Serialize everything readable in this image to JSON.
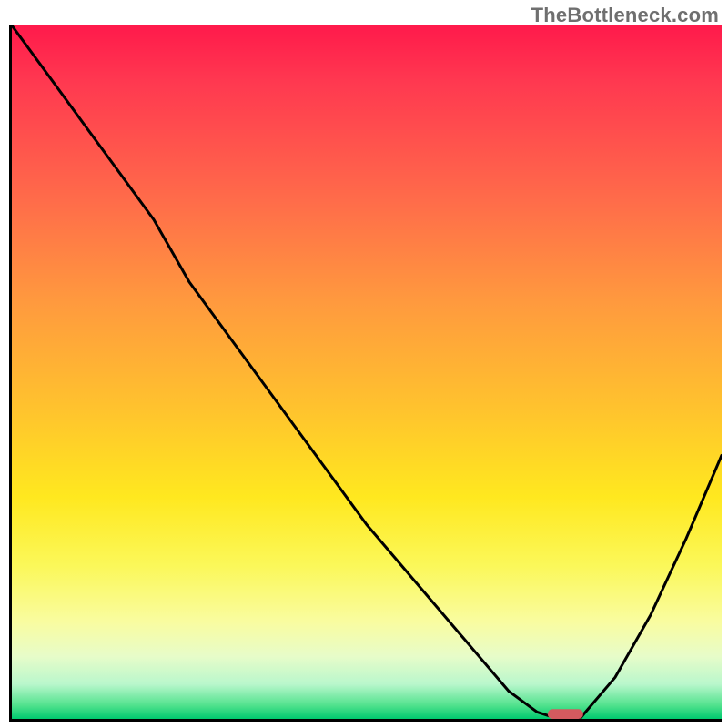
{
  "watermark": "TheBottleneck.com",
  "chart_data": {
    "type": "line",
    "title": "",
    "xlabel": "",
    "ylabel": "",
    "xlim": [
      0,
      100
    ],
    "ylim": [
      0,
      100
    ],
    "grid": false,
    "legend": false,
    "background": {
      "type": "vertical-gradient",
      "stops": [
        {
          "pos": 0.0,
          "color": "#ff1a4b"
        },
        {
          "pos": 0.08,
          "color": "#ff3850"
        },
        {
          "pos": 0.25,
          "color": "#ff6b4a"
        },
        {
          "pos": 0.4,
          "color": "#ff9a3e"
        },
        {
          "pos": 0.55,
          "color": "#ffc22e"
        },
        {
          "pos": 0.68,
          "color": "#ffe81f"
        },
        {
          "pos": 0.78,
          "color": "#fbf85a"
        },
        {
          "pos": 0.86,
          "color": "#f9fca0"
        },
        {
          "pos": 0.91,
          "color": "#e7fcc9"
        },
        {
          "pos": 0.95,
          "color": "#b9f7cc"
        },
        {
          "pos": 0.98,
          "color": "#53e28e"
        },
        {
          "pos": 1.0,
          "color": "#00c96f"
        }
      ]
    },
    "series": [
      {
        "name": "bottleneck-curve",
        "color": "#000000",
        "x": [
          0,
          5,
          10,
          15,
          20,
          25,
          30,
          35,
          40,
          45,
          50,
          55,
          60,
          65,
          70,
          74,
          77,
          80,
          85,
          90,
          95,
          100
        ],
        "y": [
          100,
          93,
          86,
          79,
          72,
          63,
          56,
          49,
          42,
          35,
          28,
          22,
          16,
          10,
          4,
          1,
          0,
          0,
          6,
          15,
          26,
          38
        ]
      }
    ],
    "marker": {
      "name": "optimal-point",
      "x": 78,
      "y": 0.7,
      "width": 5,
      "height": 1.4,
      "color": "#d45a5f"
    }
  }
}
